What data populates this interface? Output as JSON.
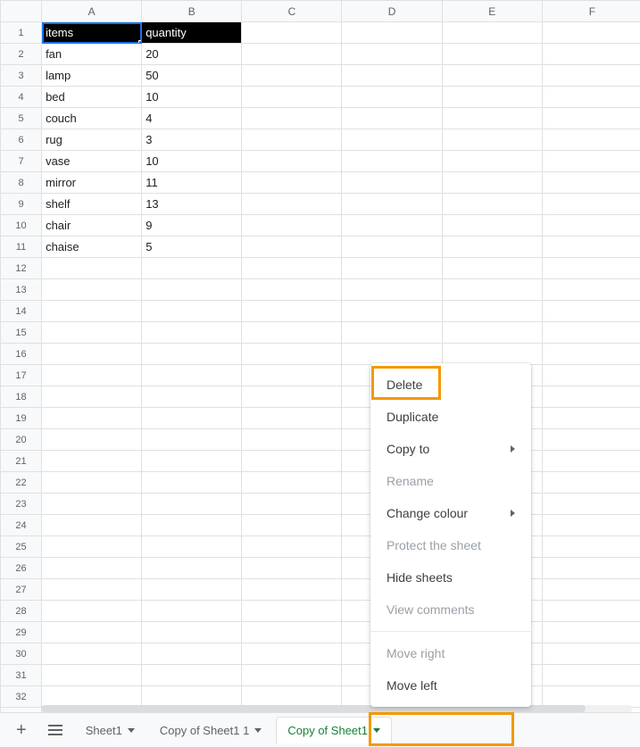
{
  "columns": [
    "A",
    "B",
    "C",
    "D",
    "E",
    "F"
  ],
  "row_count": 33,
  "header_row": {
    "A": "items",
    "B": "quantity"
  },
  "data_rows": [
    {
      "A": "fan",
      "B": "20"
    },
    {
      "A": "lamp",
      "B": "50"
    },
    {
      "A": "bed",
      "B": "10"
    },
    {
      "A": "couch",
      "B": "4"
    },
    {
      "A": "rug",
      "B": "3"
    },
    {
      "A": "vase",
      "B": "10"
    },
    {
      "A": "mirror",
      "B": "11"
    },
    {
      "A": "shelf",
      "B": "13"
    },
    {
      "A": "chair",
      "B": "9"
    },
    {
      "A": "chaise",
      "B": "5"
    }
  ],
  "active_cell": "A1",
  "context_menu": {
    "items": [
      {
        "label": "Delete",
        "enabled": true,
        "submenu": false
      },
      {
        "label": "Duplicate",
        "enabled": true,
        "submenu": false
      },
      {
        "label": "Copy to",
        "enabled": true,
        "submenu": true
      },
      {
        "label": "Rename",
        "enabled": false,
        "submenu": false
      },
      {
        "label": "Change colour",
        "enabled": true,
        "submenu": true
      },
      {
        "label": "Protect the sheet",
        "enabled": false,
        "submenu": false
      },
      {
        "label": "Hide sheets",
        "enabled": true,
        "submenu": false
      },
      {
        "label": "View comments",
        "enabled": false,
        "submenu": false
      },
      {
        "sep": true
      },
      {
        "label": "Move right",
        "enabled": false,
        "submenu": false
      },
      {
        "label": "Move left",
        "enabled": true,
        "submenu": false
      }
    ]
  },
  "tabs": [
    {
      "label": "Sheet1",
      "active": false
    },
    {
      "label": "Copy of Sheet1 1",
      "active": false
    },
    {
      "label": "Copy of Sheet1",
      "active": true
    }
  ],
  "highlights": {
    "delete_menu_item": true,
    "active_tab": true
  }
}
